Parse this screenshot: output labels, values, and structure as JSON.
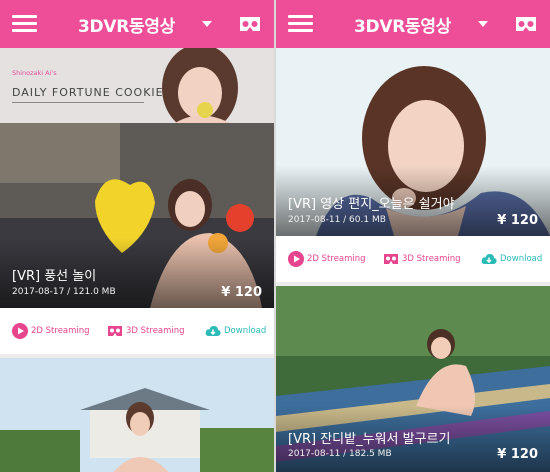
{
  "app": {
    "title": "3DVR동영상"
  },
  "colors": {
    "brand": "#ee4e97",
    "pink_action": "#e8458f",
    "teal_action": "#2bbbb7"
  },
  "icons": {
    "menu": "hamburger-menu-icon",
    "dropdown": "caret-down-icon",
    "vr": "vr-headset-icon",
    "play": "play-circle-icon",
    "download": "cloud-download-icon"
  },
  "actions": {
    "streaming_2d": "2D Streaming",
    "streaming_3d": "3D Streaming",
    "download": "Download"
  },
  "left_pane": {
    "banner": {
      "subtitle": "Shinozaki Ai's",
      "title": "DAILY FORTUNE COOKIE"
    },
    "video": {
      "title": "[VR] 풍선 놀이",
      "date_size": "2017-08-17 / 121.0 MB",
      "price": "¥ 120"
    }
  },
  "right_pane": {
    "videos": [
      {
        "title": "[VR] 영상 편지_오늘은 쉴거야",
        "date_size": "2017-08-11 / 60.1 MB",
        "price": "¥ 120"
      },
      {
        "title": "[VR] 잔디밭_누워서 발구르기",
        "date_size": "2017-08-11 / 182.5 MB",
        "price": "¥ 120"
      }
    ]
  }
}
